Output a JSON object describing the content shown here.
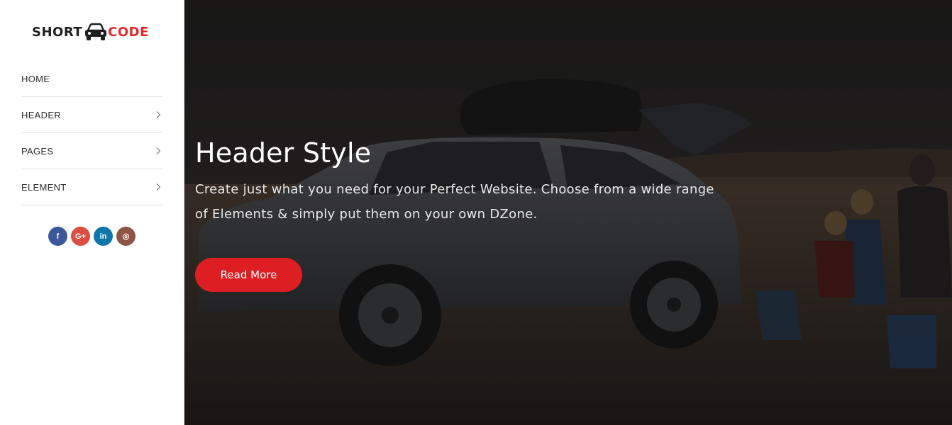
{
  "brand": {
    "left": "SHORT",
    "right": "CODE",
    "icon": "car-icon",
    "accent": "#e02b2b"
  },
  "nav": [
    {
      "label": "HOME",
      "has_submenu": false
    },
    {
      "label": "HEADER",
      "has_submenu": true
    },
    {
      "label": "PAGES",
      "has_submenu": true
    },
    {
      "label": "ELEMENT",
      "has_submenu": true
    }
  ],
  "social": [
    {
      "icon": "facebook-icon",
      "glyph": "f",
      "color": "#3b5998"
    },
    {
      "icon": "google-plus-icon",
      "glyph": "G+",
      "color": "#dc4e41"
    },
    {
      "icon": "linkedin-icon",
      "glyph": "in",
      "color": "#0e76a8"
    },
    {
      "icon": "instagram-icon",
      "glyph": "◎",
      "color": "#8e5547"
    }
  ],
  "hero": {
    "title": "Header Style",
    "text": "Create just what you need for your Perfect Website. Choose from a wide range of Elements & simply put them on your own DZone.",
    "button": "Read More",
    "button_color": "#dd1f24"
  }
}
